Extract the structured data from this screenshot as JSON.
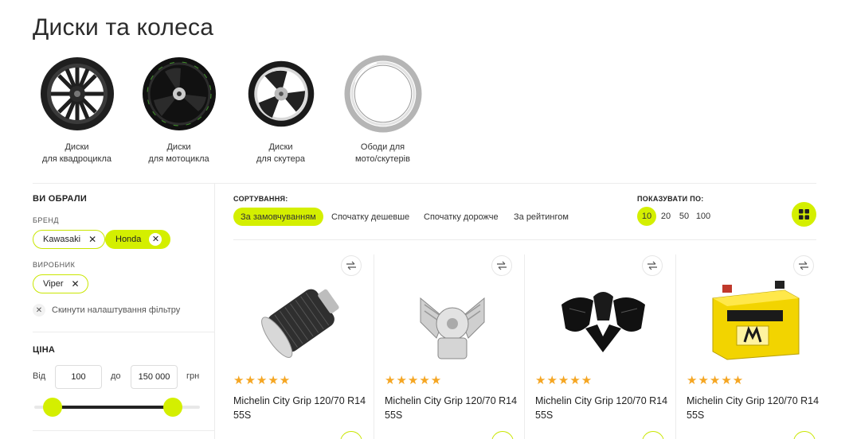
{
  "page": {
    "title": "Диски та колеса"
  },
  "categories": [
    {
      "label": "Диски\nдля квадроцикла",
      "icon": "atv-wheel-image"
    },
    {
      "label": "Диски\nдля мотоцикла",
      "icon": "motorcycle-wheel-image"
    },
    {
      "label": "Диски\nдля скутера",
      "icon": "scooter-wheel-image"
    },
    {
      "label": "Ободи для\nмото/скутерів",
      "icon": "rim-image"
    }
  ],
  "filters": {
    "heading": "ВИ ОБРАЛИ",
    "brand_label": "БРЕНД",
    "brands": [
      {
        "label": "Kawasaki",
        "active": false
      },
      {
        "label": "Honda",
        "active": true
      }
    ],
    "maker_label": "ВИРОБНИК",
    "makers": [
      {
        "label": "Viper",
        "active": false
      }
    ],
    "reset_label": "Скинути налаштування фільтру"
  },
  "price": {
    "heading": "ЦІНА",
    "from_label": "Від",
    "from_value": "100",
    "to_label": "до",
    "to_value": "150 000",
    "currency": "грн"
  },
  "sorting": {
    "label": "СОРТУВАННЯ:",
    "options": [
      "За замовчуванням",
      "Спочатку дешевше",
      "Спочатку дорожче",
      "За рейтингом"
    ],
    "active": "За замовчуванням"
  },
  "per_page": {
    "label": "ПОКАЗУВАТИ ПО:",
    "options": [
      "10",
      "20",
      "50",
      "100"
    ],
    "active": "10"
  },
  "products": [
    {
      "title": "Michelin City Grip 120/70 R14 55S",
      "stars": "★★★★★",
      "rating": 5,
      "image": "air-filter-image"
    },
    {
      "title": "Michelin City Grip 120/70 R14 55S",
      "stars": "★★★★★",
      "rating": 5,
      "image": "engine-image"
    },
    {
      "title": "Michelin City Grip 120/70 R14 55S",
      "stars": "★★★★★",
      "rating": 5,
      "image": "fairing-image"
    },
    {
      "title": "Michelin City Grip 120/70 R14 55S",
      "stars": "★★★★★",
      "rating": 5,
      "image": "battery-image"
    }
  ],
  "colors": {
    "accent": "#d4ef00",
    "star": "#f5a623",
    "text": "#222222"
  }
}
